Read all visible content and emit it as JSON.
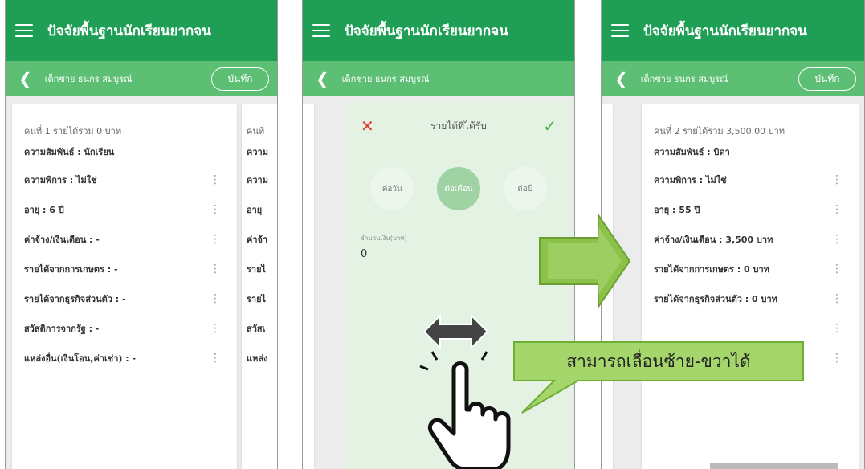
{
  "app": {
    "title": "ปัจจัยพื้นฐานนักเรียนยากจน"
  },
  "student": {
    "name": "เด็กชาย ธนกร สมบูรณ์"
  },
  "save_label": "บันทึก",
  "person1": {
    "header": "คนที่ 1 รายได้รวม 0 บาท",
    "rows": [
      "ความสัมพันธ์ : นักเรียน",
      "ความพิการ : ไม่ใช่",
      "อายุ : 6 ปี",
      "ค่าจ้าง/เงินเดือน : -",
      "รายได้จากการเกษตร : -",
      "รายได้จากธุรกิจส่วนตัว : -",
      "สวัสดิการจากรัฐ : -",
      "แหล่งอื่น(เงินโอน,ค่าเช่า) : -"
    ]
  },
  "peek1": {
    "header": "คนที่",
    "rows": [
      "ความ",
      "ความ",
      "อายุ",
      "ค่าจ้า",
      "รายไ",
      "รายไ",
      "สวัสเ",
      "แหล่ง"
    ]
  },
  "dialog": {
    "title": "รายได้ที่ได้รับ",
    "periods": [
      "ต่อวัน",
      "ต่อเดือน",
      "ต่อปี"
    ],
    "amount_label": "จำนวนเงิน(บาท)",
    "amount_value": "0"
  },
  "person2": {
    "header": "คนที่ 2 รายได้รวม 3,500.00 บาท",
    "rows": [
      "ความสัมพันธ์ : บิดา",
      "ความพิการ : ไม่ใช่",
      "อายุ : 55 ปี",
      "ค่าจ้าง/เงินเดือน : 3,500 บาท",
      "รายได้จากการเกษตร : 0 บาท",
      "รายได้จากธุรกิจส่วนตัว : 0 บาท"
    ],
    "partial_value": "0 บาท"
  },
  "tooltip": {
    "text": "สามารถเลื่อนซ้าย-ขวาได้"
  },
  "colors": {
    "appbar": "#1f9e56",
    "subbar": "#5dbf74",
    "arrow_green": "#8bc34a",
    "callout_green": "#a5d66b"
  }
}
